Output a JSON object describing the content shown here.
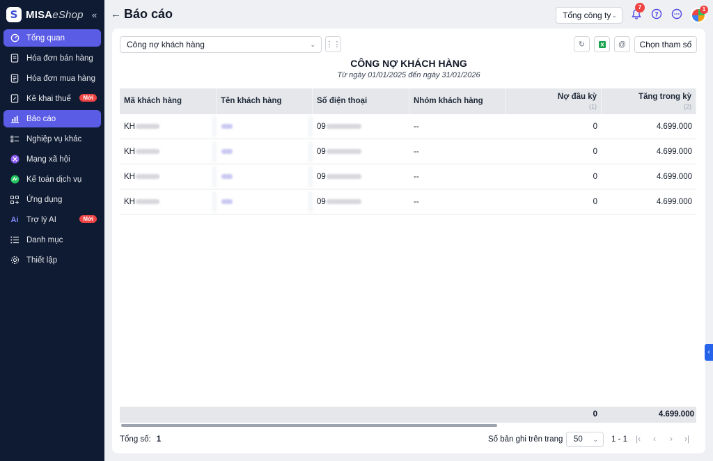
{
  "app": {
    "brand": "MISA",
    "brand_suffix": "eShop"
  },
  "sidebar": {
    "items": [
      {
        "label": "Tổng quan",
        "icon": "dashboard-icon",
        "active": true
      },
      {
        "label": "Hóa đơn bán hàng",
        "icon": "invoice-icon"
      },
      {
        "label": "Hóa đơn mua hàng",
        "icon": "purchase-invoice-icon"
      },
      {
        "label": "Kê khai thuế",
        "icon": "tax-icon",
        "badge": "Mới"
      },
      {
        "label": "Báo cáo",
        "icon": "chart-icon",
        "active": true
      },
      {
        "label": "Nghiệp vụ khác",
        "icon": "tasks-icon"
      },
      {
        "label": "Mạng xã hội",
        "icon": "social-icon"
      },
      {
        "label": "Kế toán dịch vụ",
        "icon": "accounting-icon"
      },
      {
        "label": "Ứng dụng",
        "icon": "apps-icon"
      },
      {
        "label": "Trợ lý AI",
        "icon": "ai-icon",
        "badge": "Mới"
      },
      {
        "label": "Danh mục",
        "icon": "list-icon"
      },
      {
        "label": "Thiết lập",
        "icon": "settings-icon"
      }
    ]
  },
  "header": {
    "title": "Báo cáo",
    "company": "Tổng công ty",
    "notification_count": "7",
    "avatar_badge": "1"
  },
  "report": {
    "selector": "Công nợ khách hàng",
    "params_button": "Chọn tham số",
    "title": "CÔNG NỢ KHÁCH HÀNG",
    "subtitle": "Từ ngày 01/01/2025 đến ngày 31/01/2026",
    "columns": [
      {
        "label": "Mã khách hàng"
      },
      {
        "label": "Tên khách hàng"
      },
      {
        "label": "Số điện thoại"
      },
      {
        "label": "Nhóm khách hàng"
      },
      {
        "label": "Nợ đầu kỳ",
        "index": "(1)"
      },
      {
        "label": "Tăng trong kỳ",
        "index": "(2)"
      }
    ],
    "rows": [
      {
        "code": "KH",
        "phone": "09",
        "group": "--",
        "opening": "0",
        "increase": "4.699.000"
      },
      {
        "code": "KH",
        "phone": "09",
        "group": "--",
        "opening": "0",
        "increase": "4.699.000"
      },
      {
        "code": "KH",
        "phone": "09",
        "group": "--",
        "opening": "0",
        "increase": "4.699.000"
      },
      {
        "code": "KH",
        "phone": "09",
        "group": "--",
        "opening": "0",
        "increase": "4.699.000"
      }
    ],
    "totals": {
      "opening": "0",
      "increase": "4.699.000"
    }
  },
  "footer": {
    "total_label": "Tổng số:",
    "total_value": "1",
    "per_page_label": "Số bản ghi trên trang",
    "per_page_value": "50",
    "range": "1 - 1"
  }
}
